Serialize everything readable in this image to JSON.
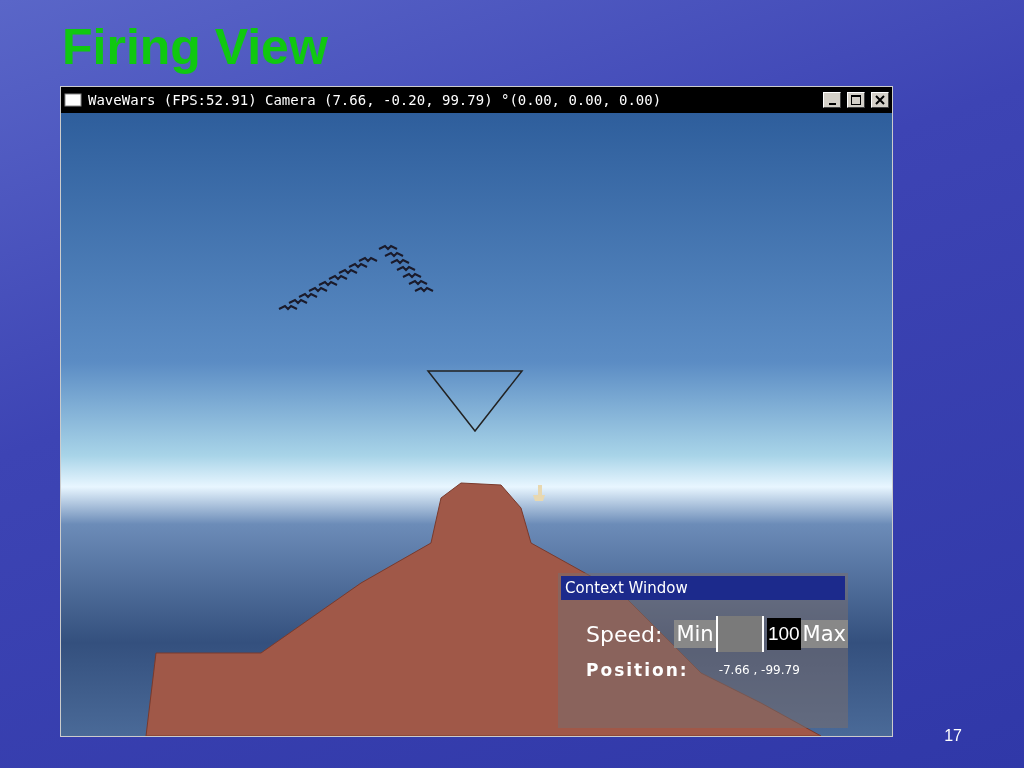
{
  "slide": {
    "title": "Firing View",
    "page_number": "17"
  },
  "window": {
    "title": "WaveWars (FPS:52.91) Camera (7.66, -0.20, 99.79) °(0.00, 0.00, 0.00)"
  },
  "context_window": {
    "title": "Context Window",
    "speed_label": "Speed:",
    "speed_min": "Min",
    "speed_value": "100",
    "speed_max": "Max",
    "level": 1,
    "position_label": "Position:",
    "position_value": "-7.66 , -99.79"
  }
}
